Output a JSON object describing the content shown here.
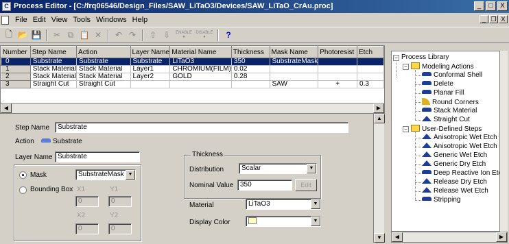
{
  "window": {
    "title": "Process Editor - [C:/frq06546/Design_Files/SAW_LiTaO3/Devices/SAW_LiTaO_CrAu.proc]",
    "app_icon": "process-editor-icon",
    "controls": {
      "minimize": "_",
      "maximize": "□",
      "close": "X"
    }
  },
  "menu": {
    "items": [
      "File",
      "Edit",
      "View",
      "Tools",
      "Windows",
      "Help"
    ],
    "mdi_controls": {
      "minimize": "_",
      "restore": "❐",
      "close": "X"
    }
  },
  "toolbar": {
    "buttons": [
      "new-icon",
      "open-icon",
      "save-icon",
      "cut-icon",
      "copy-icon",
      "paste-icon",
      "delete-icon",
      "undo-icon",
      "redo-icon",
      "move-up-icon",
      "move-down-icon",
      "enable-icon",
      "disable-icon",
      "help-icon"
    ],
    "enable_label": "ENABLE",
    "disable_label": "DISABLE",
    "help_label": "?"
  },
  "grid": {
    "columns": [
      "Number",
      "Step Name",
      "Action",
      "Layer Name",
      "Material Name",
      "Thickness",
      "Mask Name",
      "Photoresist",
      "Etch"
    ],
    "rows": [
      {
        "number": "0",
        "step_name": "Substrate",
        "action": "Substrate",
        "layer_name": "Substrate",
        "material": "LiTaO3",
        "thickness": "350",
        "mask": "SubstrateMask",
        "photoresist": "",
        "etch": "",
        "selected": true
      },
      {
        "number": "1",
        "step_name": "Stack Material",
        "action": "Stack Material",
        "layer_name": "Layer1",
        "material": "CHROMIUM(FILM)",
        "thickness": "0.02",
        "mask": "",
        "photoresist": "",
        "etch": "",
        "selected": false
      },
      {
        "number": "2",
        "step_name": "Stack Material",
        "action": "Stack Material",
        "layer_name": "Layer2",
        "material": "GOLD",
        "thickness": "0.28",
        "mask": "",
        "photoresist": "",
        "etch": "",
        "selected": false
      },
      {
        "number": "3",
        "step_name": "Straight Cut",
        "action": "Straight Cut",
        "layer_name": "",
        "material": "",
        "thickness": "",
        "mask": "SAW",
        "photoresist": "+",
        "etch": "0.3",
        "selected": false
      }
    ]
  },
  "properties": {
    "step_name_label": "Step Name",
    "step_name_value": "Substrate",
    "action_label": "Action",
    "action_value": "Substrate",
    "layer_name_label": "Layer Name",
    "layer_name_value": "Substrate",
    "mask_label": "Mask",
    "mask_value": "SubstrateMask",
    "bounding_box_label": "Bounding Box",
    "x1_label": "X1",
    "y1_label": "Y1",
    "x2_label": "X2",
    "y2_label": "Y2",
    "x1_value": "0",
    "y1_value": "0",
    "x2_value": "0",
    "y2_value": "0",
    "mask_mode": "mask",
    "thickness_group": "Thickness",
    "distribution_label": "Distribution",
    "distribution_value": "Scalar",
    "nominal_label": "Nominal Value",
    "nominal_value": "350",
    "edit_label": "Edit",
    "material_label": "Material",
    "material_value": "LiTaO3",
    "display_color_label": "Display Color",
    "display_color": "#ffffc0"
  },
  "library": {
    "root": "Process Library",
    "groups": [
      {
        "label": "Modeling Actions",
        "items": [
          "Conformal Shell",
          "Delete",
          "Planar Fill",
          "Round Corners",
          "Stack Material",
          "Straight Cut"
        ]
      },
      {
        "label": "User-Defined Steps",
        "items": [
          "Anisotropic Wet Etch - B",
          "Anisotropic Wet Etch - I",
          "Generic Wet Etch",
          "Generic Dry Etch",
          "Deep Reactive Ion Etcl",
          "Release Dry Etch",
          "Release Wet Etch",
          "Stripping"
        ]
      }
    ]
  },
  "colors": {
    "title_bar": "#0a246a",
    "selection": "#0a246a",
    "face": "#d4d0c8",
    "icon_blue": "#1e3c9a"
  }
}
